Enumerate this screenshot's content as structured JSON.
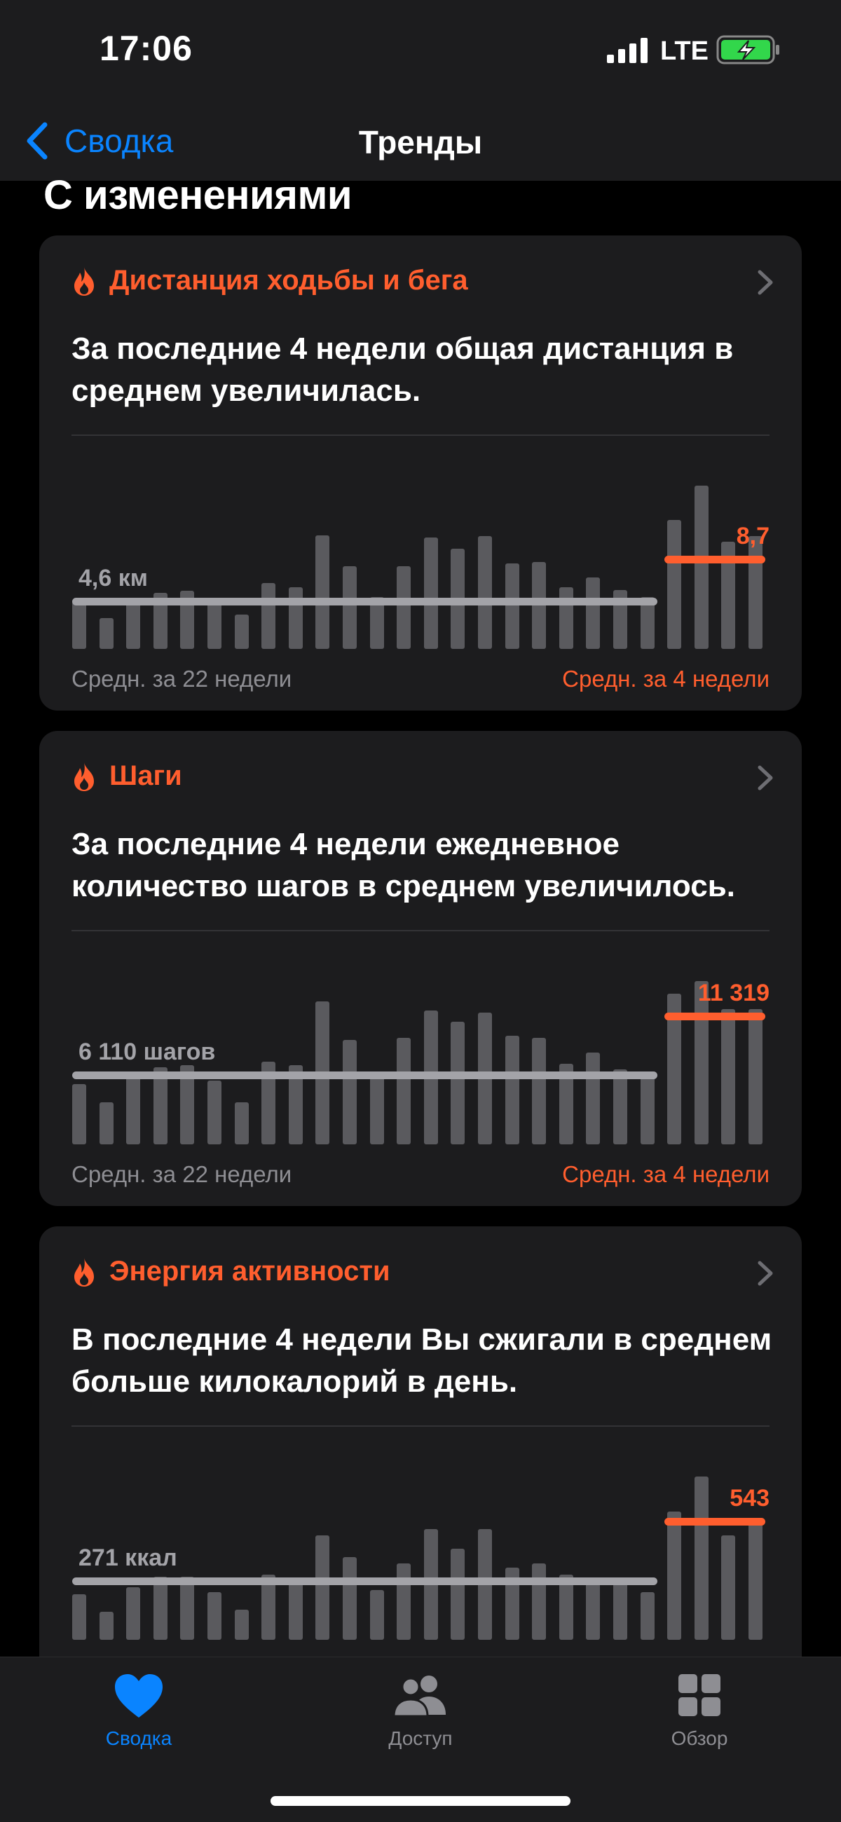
{
  "status": {
    "time": "17:06",
    "network": "LTE",
    "icons": [
      "signal-icon",
      "battery-charging-icon"
    ]
  },
  "nav": {
    "back_label": "Сводка",
    "title": "Тренды",
    "back_icon": "chevron-left-icon"
  },
  "section": {
    "header": "С изменениями"
  },
  "cards": [
    {
      "title": "Дистанция ходьбы и бега",
      "description": "За последние 4 недели общая дистанция в среднем увеличилась.",
      "baseline_label": "4,6 км",
      "recent_label": "8,7",
      "footer_left": "Средн. за 22 недели",
      "footer_right": "Средн. за 4 недели",
      "chart_data": {
        "type": "bar",
        "baseline_average": 4.6,
        "recent_average": 8.7,
        "values": [
          4.6,
          3.0,
          4.9,
          5.4,
          5.6,
          4.4,
          3.3,
          6.4,
          6.0,
          11.0,
          8.0,
          5.0,
          8.0,
          10.8,
          9.7,
          10.9,
          8.3,
          8.4,
          6.0,
          6.9,
          5.7,
          5.0,
          12.5,
          15.8,
          10.4,
          10.9
        ],
        "highlight_last": 4
      }
    },
    {
      "title": "Шаги",
      "description": "За последние 4 недели ежедневное количество шагов в среднем увеличилось.",
      "baseline_label": "6 110 шагов",
      "recent_label": "11 319",
      "footer_left": "Средн. за 22 недели",
      "footer_right": "Средн. за 4 недели",
      "chart_data": {
        "type": "bar",
        "baseline_average": 6110,
        "recent_average": 11319,
        "values": [
          5300,
          3700,
          6000,
          6800,
          7000,
          5600,
          3700,
          7300,
          7000,
          12600,
          9200,
          6100,
          9400,
          11800,
          10800,
          11600,
          9600,
          9400,
          7100,
          8100,
          6600,
          6300,
          13300,
          14400,
          11900,
          11900
        ],
        "highlight_last": 4
      }
    },
    {
      "title": "Энергия активности",
      "description": "В последние 4 недели Вы сжигали в среднем больше килокалорий в день.",
      "baseline_label": "271 ккал",
      "recent_label": "543",
      "footer_left": "",
      "footer_right": "",
      "chart_data": {
        "type": "bar",
        "baseline_average": 271,
        "recent_average": 543,
        "values": [
          210,
          130,
          240,
          290,
          290,
          220,
          140,
          300,
          280,
          480,
          380,
          230,
          350,
          510,
          420,
          510,
          330,
          350,
          300,
          260,
          270,
          220,
          590,
          750,
          480,
          560
        ],
        "highlight_last": 4
      }
    }
  ],
  "tabs": [
    {
      "label": "Сводка",
      "icon": "heart-icon",
      "selected": true
    },
    {
      "label": "Доступ",
      "icon": "people-icon",
      "selected": false
    },
    {
      "label": "Обзор",
      "icon": "grid-icon",
      "selected": false
    }
  ],
  "colors": {
    "accent": "#ff5e2e",
    "tint": "#0a84ff",
    "card": "#1c1c1e",
    "bar": "#5a5a5e",
    "baseline": "#a3a3a8"
  }
}
